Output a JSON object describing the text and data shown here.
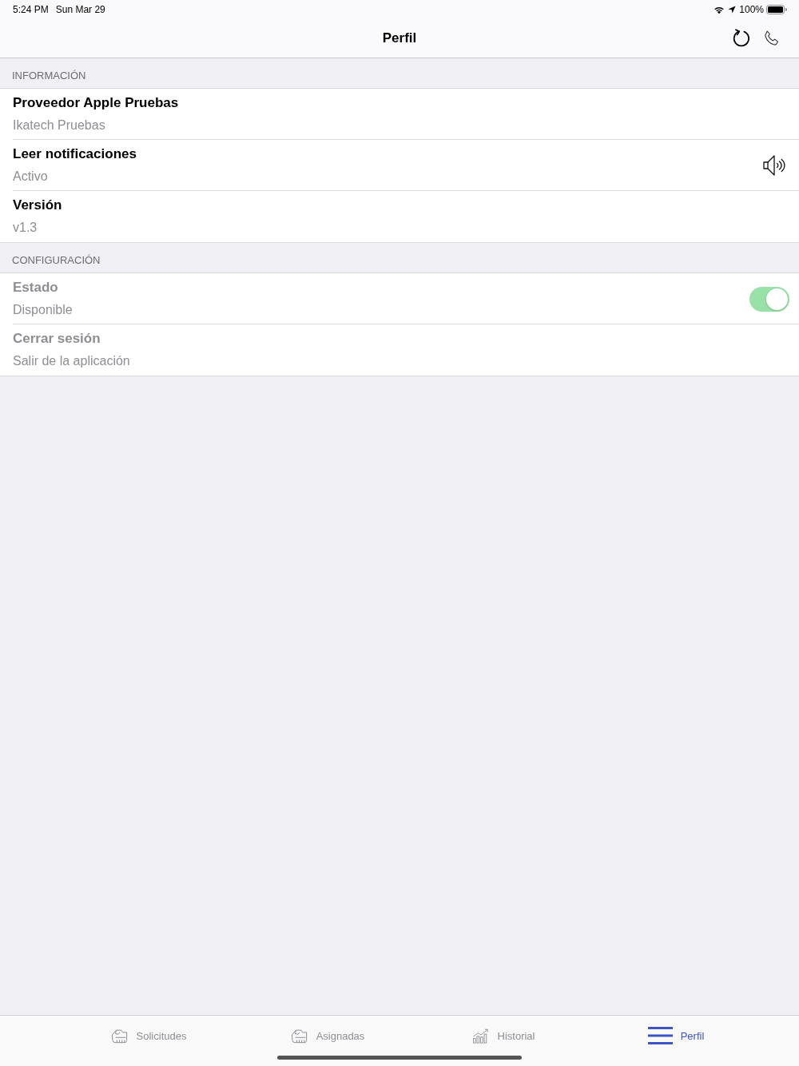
{
  "status_bar": {
    "time": "5:24 PM",
    "date": "Sun Mar 29",
    "battery": "100%"
  },
  "nav_bar": {
    "title": "Perfil"
  },
  "sections": [
    {
      "header": "INFORMACIÓN",
      "rows": [
        {
          "kind": "text",
          "title": "Proveedor Apple Pruebas",
          "subtitle": "Ikatech Pruebas",
          "disabled": false
        },
        {
          "kind": "speaker",
          "title": "Leer notificaciones",
          "subtitle": "Activo",
          "disabled": false
        },
        {
          "kind": "text",
          "title": "Versión",
          "subtitle": "v1.3",
          "disabled": false
        }
      ]
    },
    {
      "header": "CONFIGURACIÓN",
      "rows": [
        {
          "kind": "toggle",
          "title": "Estado",
          "subtitle": "Disponible",
          "disabled": true,
          "on": true
        },
        {
          "kind": "text",
          "title": "Cerrar sesión",
          "subtitle": "Salir de la aplicación",
          "disabled": true
        }
      ]
    }
  ],
  "tab_bar": [
    {
      "kind": "hand",
      "label": "Solicitudes",
      "selected": false
    },
    {
      "kind": "hand",
      "label": "Asignadas",
      "selected": false
    },
    {
      "kind": "chart",
      "label": "Historial",
      "selected": false
    },
    {
      "kind": "menu",
      "label": "Perfil",
      "selected": true
    }
  ]
}
